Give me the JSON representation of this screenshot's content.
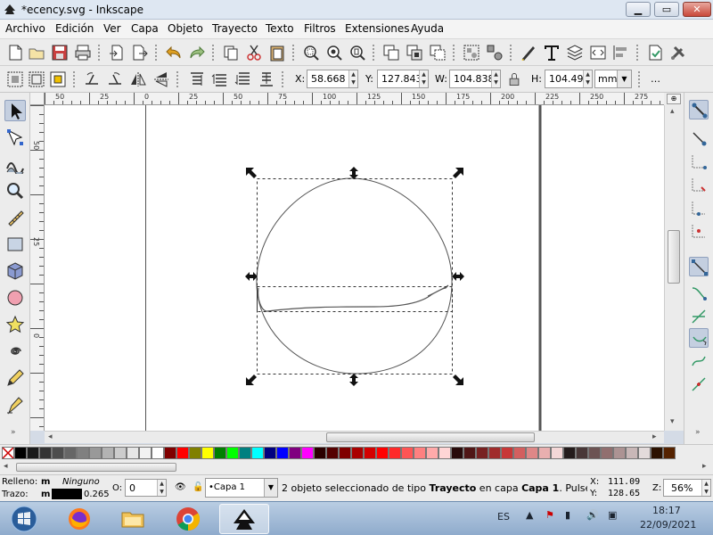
{
  "window": {
    "title": "*ecency.svg - Inkscape",
    "minimize_icon": "minimize-icon",
    "maximize_icon": "maximize-icon",
    "close_icon": "close-icon"
  },
  "menu": [
    "Archivo",
    "Edición",
    "Ver",
    "Capa",
    "Objeto",
    "Trayecto",
    "Texto",
    "Filtros",
    "Extensiones",
    "Ayuda"
  ],
  "toolbar_commands": [
    "new-document-icon",
    "open-icon",
    "save-icon",
    "print-icon",
    "import-icon",
    "export-icon",
    "undo-icon",
    "redo-icon",
    "copy-icon",
    "cut-icon",
    "paste-icon",
    "zoom-selection-icon",
    "zoom-drawing-icon",
    "zoom-page-icon",
    "duplicate-icon",
    "clone-icon",
    "unlink-clone-icon",
    "group-icon",
    "ungroup-icon",
    "fill-stroke-icon",
    "text-font-icon",
    "layers-icon",
    "xml-editor-icon",
    "align-icon",
    "document-properties-icon",
    "preferences-icon"
  ],
  "controls": {
    "x_label": "X:",
    "x_value": "58.668",
    "y_label": "Y:",
    "y_value": "127.843",
    "w_label": "W:",
    "w_value": "104.838",
    "h_label": "H:",
    "h_value": "104.497",
    "unit": "mm"
  },
  "tools": [
    "selector-tool-icon",
    "node-tool-icon",
    "tweak-tool-icon",
    "zoom-tool-icon",
    "measure-tool-icon",
    "rectangle-tool-icon",
    "3d-box-tool-icon",
    "ellipse-tool-icon",
    "star-tool-icon",
    "spiral-tool-icon",
    "pencil-tool-icon",
    "pen-tool-icon"
  ],
  "active_tool": "selector-tool-icon",
  "ruler": {
    "h_ticks": [
      "50",
      "25",
      "0",
      "25",
      "50",
      "75",
      "100",
      "125",
      "150",
      "175",
      "200",
      "225",
      "250",
      "275"
    ],
    "v_ticks": [
      "50",
      "25",
      "0",
      "25",
      "50",
      "75",
      "100",
      "125",
      "150"
    ]
  },
  "palette": {
    "none_label": "none-swatch-icon",
    "colors": [
      "#000000",
      "#1a1a1a",
      "#333333",
      "#4d4d4d",
      "#666666",
      "#808080",
      "#999999",
      "#b3b3b3",
      "#cccccc",
      "#e6e6e6",
      "#f2f2f2",
      "#ffffff",
      "#800000",
      "#ff0000",
      "#808000",
      "#ffff00",
      "#008000",
      "#00ff00",
      "#008080",
      "#00ffff",
      "#000080",
      "#0000ff",
      "#800080",
      "#ff00ff",
      "#2b0000",
      "#550000",
      "#800000",
      "#aa0000",
      "#d40000",
      "#ff0000",
      "#ff2a2a",
      "#ff5555",
      "#ff8080",
      "#ffaaaa",
      "#ffd5d5",
      "#280b0b",
      "#501616",
      "#782121",
      "#a02c2c",
      "#c83737",
      "#d35f5f",
      "#de8787",
      "#e9afaf",
      "#f4d7d7",
      "#241c1c",
      "#483737",
      "#6c5353",
      "#916f6f",
      "#ac9393",
      "#c8b7b7",
      "#e3dbdb",
      "#2b1100",
      "#552200"
    ]
  },
  "status": {
    "fill_label": "Relleno:",
    "fill_mode": "m",
    "fill_value": "Ninguno",
    "stroke_label": "Trazo:",
    "stroke_mode": "m",
    "stroke_width": "0.265",
    "opacity_label": "O:",
    "opacity_value": "0",
    "layer": "•Capa 1",
    "message_pre": "2 objeto seleccionado de tipo ",
    "message_type": "Trayecto",
    "message_mid": " en capa ",
    "message_layer": "Capa 1",
    "message_post": ". Pulse e...",
    "cursor_x_label": "X:",
    "cursor_x": "111.09",
    "cursor_y_label": "Y:",
    "cursor_y": "128.65",
    "zoom_label": "Z:",
    "zoom_value": "56%"
  },
  "taskbar": {
    "apps": [
      "start-orb-icon",
      "firefox-icon",
      "file-explorer-icon",
      "chrome-icon",
      "inkscape-icon"
    ],
    "active_app": "inkscape-icon",
    "language": "ES",
    "time": "18:17",
    "date": "22/09/2021"
  }
}
